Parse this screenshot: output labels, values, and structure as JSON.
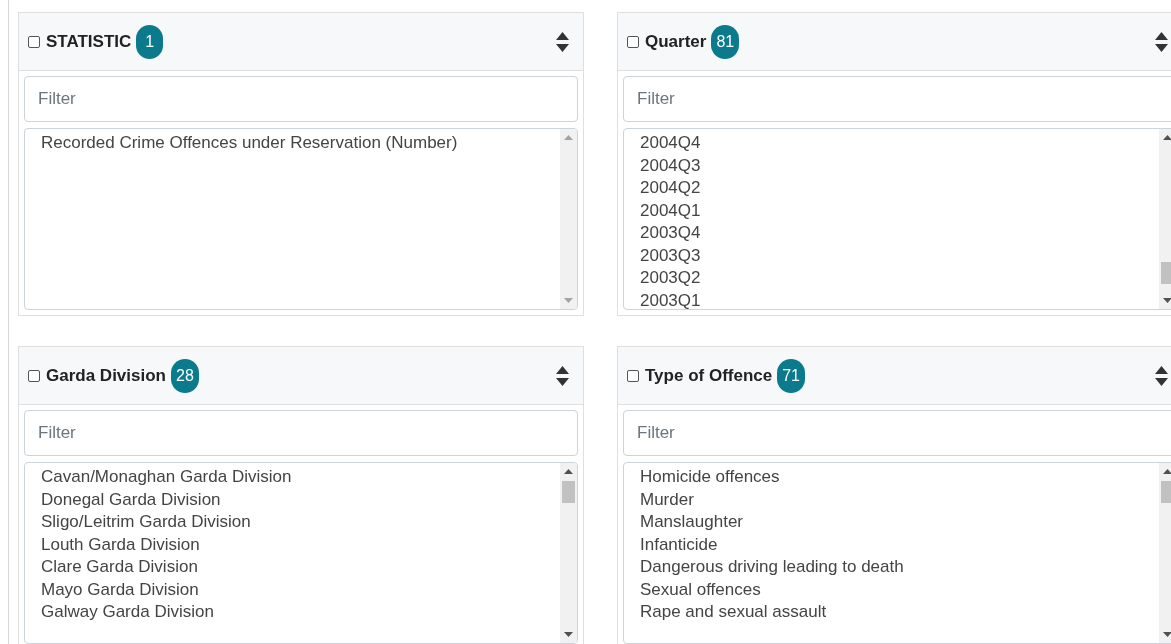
{
  "panels": [
    {
      "title": "STATISTIC",
      "count": "1",
      "checked": false,
      "filter": {
        "placeholder": "Filter"
      },
      "items": [
        "Recorded Crime Offences under Reservation (Number)"
      ]
    },
    {
      "title": "Quarter",
      "count": "81",
      "checked": false,
      "filter": {
        "placeholder": "Filter"
      },
      "items": [
        "2004Q4",
        "2004Q3",
        "2004Q2",
        "2004Q1",
        "2003Q4",
        "2003Q3",
        "2003Q2",
        "2003Q1"
      ]
    },
    {
      "title": "Garda Division",
      "count": "28",
      "checked": false,
      "filter": {
        "placeholder": "Filter"
      },
      "items": [
        "Cavan/Monaghan Garda Division",
        "Donegal Garda Division",
        "Sligo/Leitrim Garda Division",
        "Louth Garda Division",
        "Clare Garda Division",
        "Mayo Garda Division",
        "Galway Garda Division"
      ]
    },
    {
      "title": "Type of Offence",
      "count": "71",
      "checked": false,
      "filter": {
        "placeholder": "Filter"
      },
      "items": [
        "Homicide offences",
        "Murder",
        "Manslaughter",
        "Infanticide",
        "Dangerous driving leading to death",
        "Sexual offences",
        "Rape and sexual assault"
      ]
    }
  ]
}
